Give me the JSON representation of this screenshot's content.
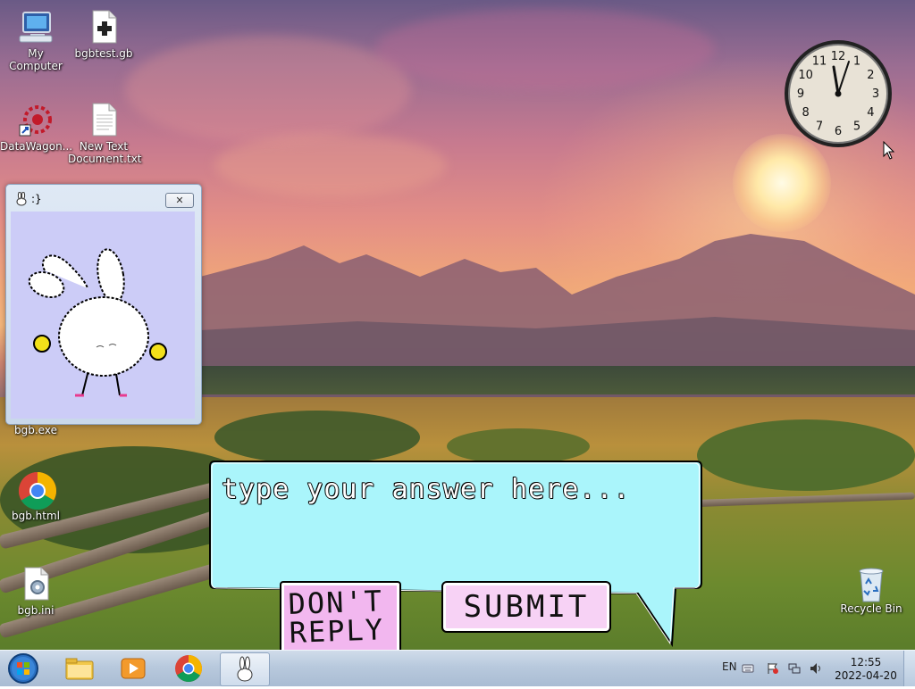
{
  "desktop": {
    "icons": [
      {
        "label": "My Computer",
        "icon": "computer-icon"
      },
      {
        "label": "bgbtest.gb",
        "icon": "gameboy-file-icon"
      },
      {
        "label": "DataWagon...",
        "icon": "datawagon-shortcut-icon"
      },
      {
        "label": "New Text Document.txt",
        "icon": "text-file-icon"
      },
      {
        "label": "bgb.exe",
        "icon": "bunny-app-icon"
      },
      {
        "label": "bgb.html",
        "icon": "chrome-file-icon"
      },
      {
        "label": "bgb.ini",
        "icon": "settings-file-icon"
      },
      {
        "label": "Recycle Bin",
        "icon": "recycle-bin-icon"
      }
    ]
  },
  "clock_gadget": {
    "numbers": [
      "12",
      "1",
      "2",
      "3",
      "4",
      "5",
      "6",
      "7",
      "8",
      "9",
      "10",
      "11"
    ]
  },
  "bgb_window": {
    "title": ":}",
    "close_glyph": "✕"
  },
  "answer_box": {
    "placeholder": "type your answer here...",
    "value": ""
  },
  "buttons": {
    "dont_reply": "DON'T REPLY",
    "submit": "SUBMIT"
  },
  "taskbar": {
    "items": [
      {
        "icon": "start-orb-icon"
      },
      {
        "icon": "explorer-folder-icon"
      },
      {
        "icon": "media-player-icon"
      },
      {
        "icon": "chrome-icon"
      },
      {
        "icon": "bunny-app-icon",
        "active": true
      }
    ],
    "language": "EN",
    "time": "12:55",
    "date": "2022-04-20"
  },
  "colors": {
    "answer_bg": "#aaf5fb",
    "dont_reply_bg": "#f2b7ef",
    "submit_bg": "#f7d2f5",
    "window_client_bg": "#ccccf7"
  }
}
